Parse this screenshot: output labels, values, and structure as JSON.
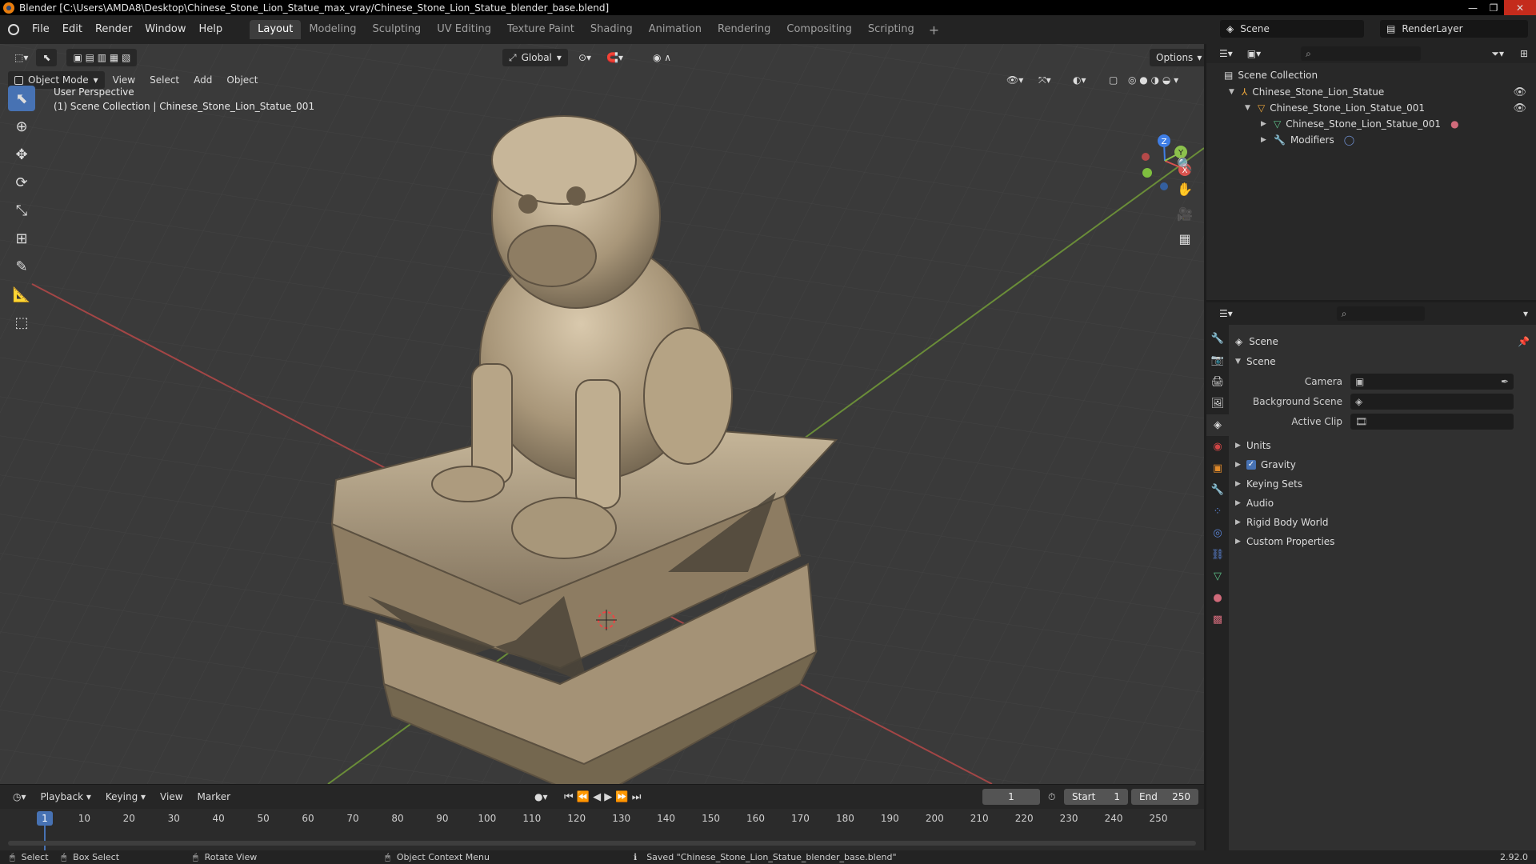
{
  "window": {
    "title": "Blender [C:\\Users\\AMDA8\\Desktop\\Chinese_Stone_Lion_Statue_max_vray/Chinese_Stone_Lion_Statue_blender_base.blend]"
  },
  "menus": [
    "File",
    "Edit",
    "Render",
    "Window",
    "Help"
  ],
  "workspaces": [
    {
      "label": "Layout",
      "active": true
    },
    {
      "label": "Modeling",
      "active": false
    },
    {
      "label": "Sculpting",
      "active": false
    },
    {
      "label": "UV Editing",
      "active": false
    },
    {
      "label": "Texture Paint",
      "active": false
    },
    {
      "label": "Shading",
      "active": false
    },
    {
      "label": "Animation",
      "active": false
    },
    {
      "label": "Rendering",
      "active": false
    },
    {
      "label": "Compositing",
      "active": false
    },
    {
      "label": "Scripting",
      "active": false
    }
  ],
  "scene_selector": "Scene",
  "view_layer": "RenderLayer",
  "viewport": {
    "transform_orientation": "Global",
    "options_label": "Options",
    "mode": "Object Mode",
    "header_menus": [
      "View",
      "Select",
      "Add",
      "Object"
    ],
    "perspective_text": "User Perspective",
    "collection_text": "(1) Scene Collection | Chinese_Stone_Lion_Statue_001",
    "axes": {
      "x": "X",
      "y": "Y",
      "z": "Z"
    }
  },
  "timeline": {
    "menus": [
      "Playback",
      "Keying",
      "View",
      "Marker"
    ],
    "current_frame": "1",
    "start_label": "Start",
    "start_value": "1",
    "end_label": "End",
    "end_value": "250",
    "ticks": [
      "1",
      "10",
      "20",
      "30",
      "40",
      "50",
      "60",
      "70",
      "80",
      "90",
      "100",
      "110",
      "120",
      "130",
      "140",
      "150",
      "160",
      "170",
      "180",
      "190",
      "200",
      "210",
      "220",
      "230",
      "240",
      "250"
    ]
  },
  "outliner": {
    "root": "Scene Collection",
    "items": [
      "Chinese_Stone_Lion_Statue",
      "Chinese_Stone_Lion_Statue_001",
      "Chinese_Stone_Lion_Statue_001",
      "Modifiers"
    ]
  },
  "properties": {
    "context_title": "Scene",
    "panel_title": "Scene",
    "fields": [
      {
        "label": "Camera"
      },
      {
        "label": "Background Scene"
      },
      {
        "label": "Active Clip"
      }
    ],
    "collapsed_panels": [
      "Units",
      "Gravity",
      "Keying Sets",
      "Audio",
      "Rigid Body World",
      "Custom Properties"
    ],
    "gravity_checked": true
  },
  "statusbar": {
    "select": "Select",
    "box_select": "Box Select",
    "rotate_view": "Rotate View",
    "context_menu": "Object Context Menu",
    "message": "Saved \"Chinese_Stone_Lion_Statue_blender_base.blend\"",
    "version": "2.92.0"
  },
  "colors": {
    "accent": "#4772b3",
    "x_axis": "#d9534f",
    "y_axis": "#8cc24c",
    "z_axis": "#3f7ee6"
  }
}
